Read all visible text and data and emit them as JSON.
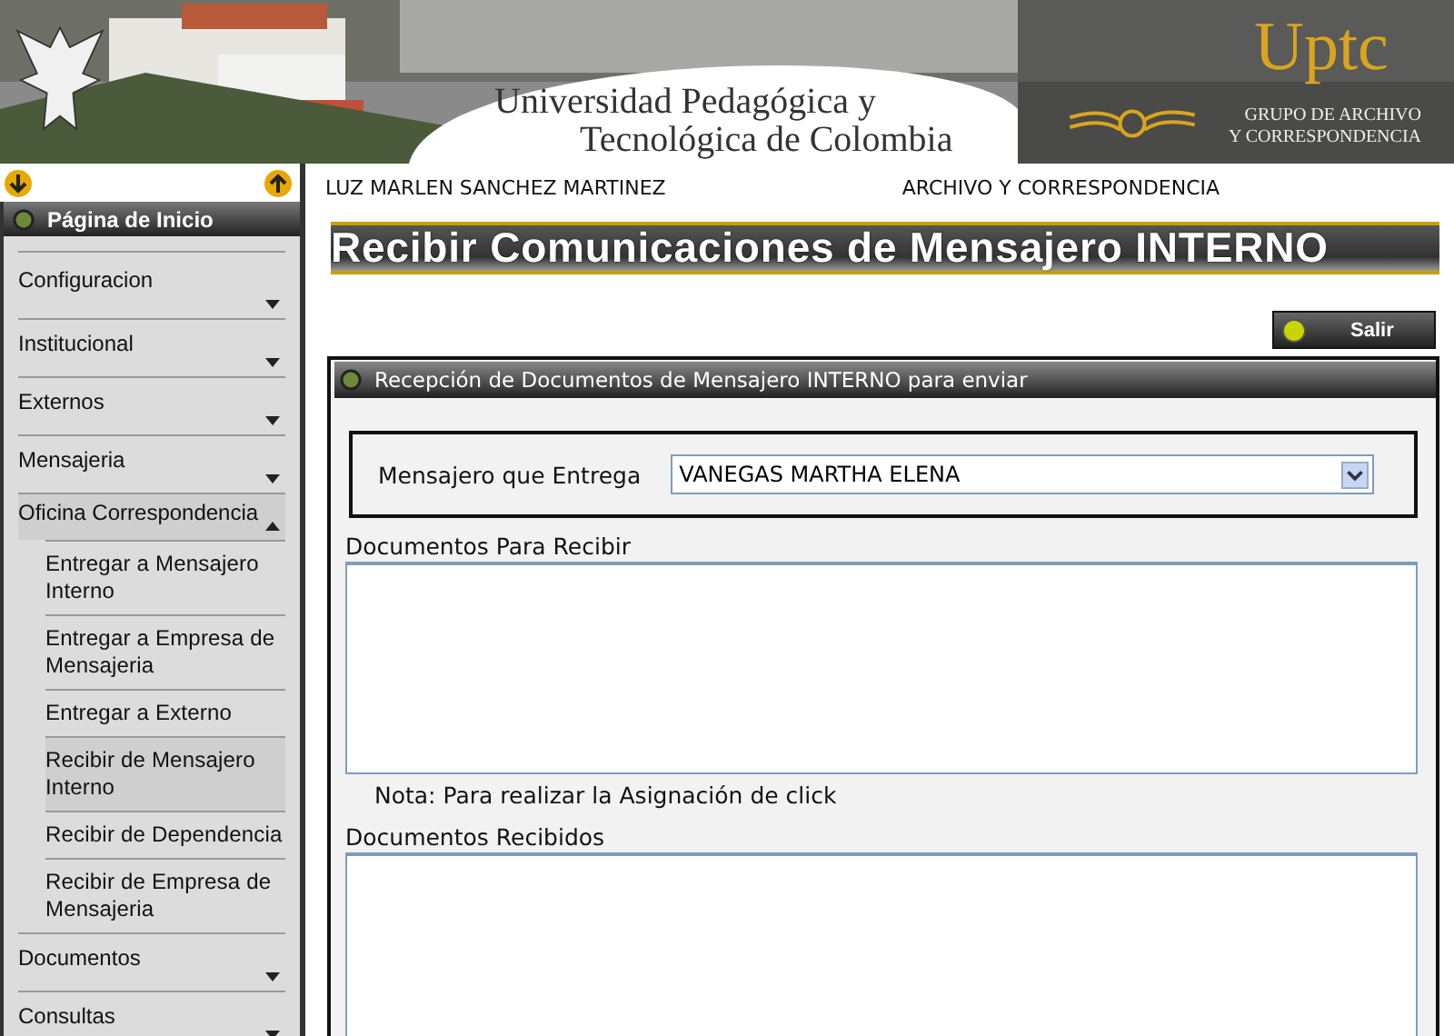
{
  "header": {
    "university": [
      "Universidad Pedagógica y",
      "Tecnológica de Colombia"
    ],
    "logo": "Uptc",
    "group": [
      "GRUPO DE ARCHIVO",
      "Y CORRESPONDENCIA"
    ]
  },
  "sidebar": {
    "title": "Página de Inicio",
    "items": [
      {
        "label": "Configuracion",
        "expanded": false
      },
      {
        "label": "Institucional",
        "expanded": false
      },
      {
        "label": "Externos",
        "expanded": false
      },
      {
        "label": "Mensajeria",
        "expanded": false
      },
      {
        "label": "Oficina Correspondencia",
        "expanded": true,
        "children": [
          {
            "label": "Entregar a Mensajero Interno",
            "selected": false
          },
          {
            "label": "Entregar a Empresa de Mensajeria",
            "selected": false
          },
          {
            "label": "Entregar a Externo",
            "selected": false
          },
          {
            "label": "Recibir de Mensajero Interno",
            "selected": true
          },
          {
            "label": "Recibir de Dependencia",
            "selected": false
          },
          {
            "label": "Recibir de Empresa de Mensajeria",
            "selected": false
          }
        ]
      },
      {
        "label": "Documentos",
        "expanded": false
      },
      {
        "label": "Consultas",
        "expanded": false
      }
    ]
  },
  "user": "LUZ MARLEN SANCHEZ MARTINEZ",
  "department": "ARCHIVO Y CORRESPONDENCIA",
  "page_title": "Recibir Comunicaciones de Mensajero INTERNO",
  "exit_button": "Salir",
  "panel": {
    "title": "Recepción de Documentos de Mensajero INTERNO para enviar",
    "messenger_label": "Mensajero que Entrega",
    "messenger_value": "VANEGAS MARTHA ELENA",
    "to_receive_label": "Documentos Para Recibir",
    "note": "Nota: Para realizar la Asignación de click",
    "received_label": "Documentos Recibidos"
  }
}
